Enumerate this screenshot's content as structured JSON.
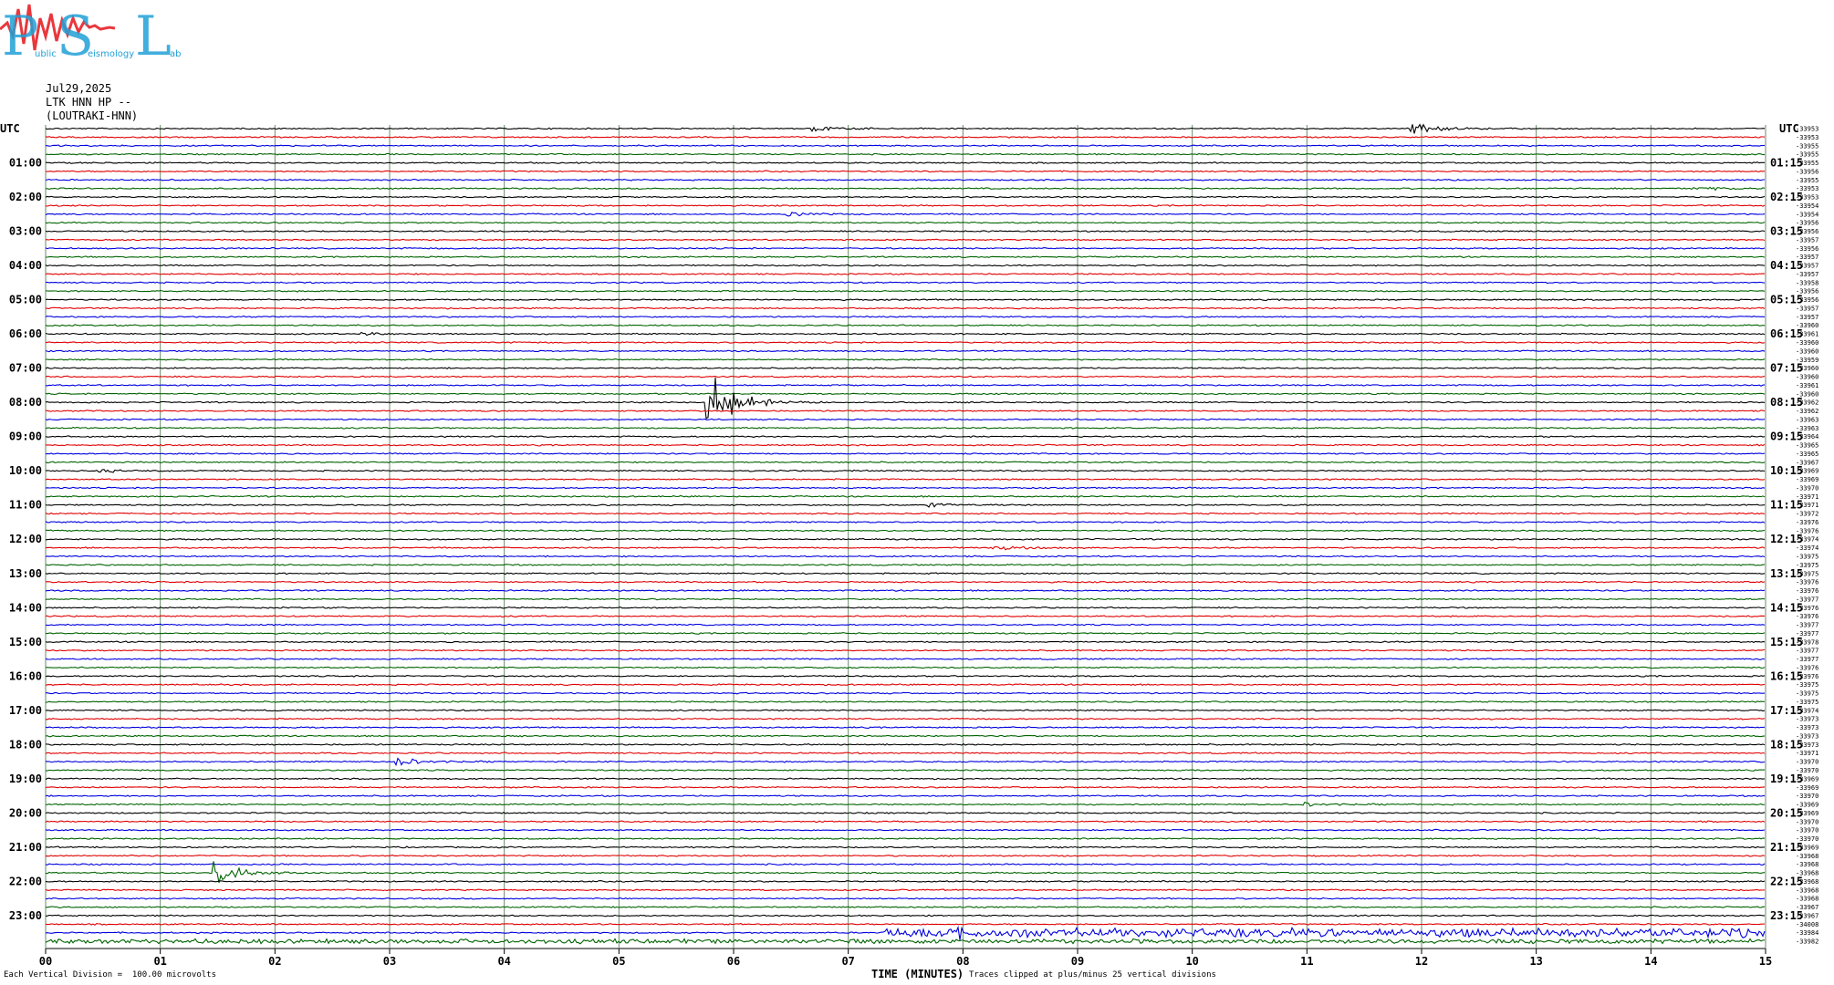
{
  "logo": {
    "letters": [
      "P",
      "S",
      "L"
    ],
    "words": [
      "ublic",
      "eismology",
      "ab"
    ],
    "colors": {
      "letters": "#22a0d6",
      "wave": "#e8383d"
    }
  },
  "header": {
    "date": "Jul29,2025",
    "station": "LTK HNN HP --",
    "location": "(LOUTRAKI-HNN)"
  },
  "chart_data": {
    "type": "line",
    "title": "",
    "xlabel": "TIME (MINUTES)",
    "xlim": [
      0,
      15
    ],
    "x_ticks": [
      "00",
      "01",
      "02",
      "03",
      "04",
      "05",
      "06",
      "07",
      "08",
      "09",
      "10",
      "11",
      "12",
      "13",
      "14",
      "15"
    ],
    "left_axis_label": "UTC",
    "right_axis_label": "UTC",
    "left_hour_labels": [
      "01:00",
      "02:00",
      "03:00",
      "04:00",
      "05:00",
      "06:00",
      "07:00",
      "08:00",
      "09:00",
      "10:00",
      "11:00",
      "12:00",
      "13:00",
      "14:00",
      "15:00",
      "16:00",
      "17:00",
      "18:00",
      "19:00",
      "20:00",
      "21:00",
      "22:00",
      "23:00"
    ],
    "right_hour_labels": [
      "01:15",
      "02:15",
      "03:15",
      "04:15",
      "05:15",
      "06:15",
      "07:15",
      "08:15",
      "09:15",
      "10:15",
      "11:15",
      "12:15",
      "13:15",
      "14:15",
      "15:15",
      "16:15",
      "17:15",
      "18:15",
      "19:15",
      "20:15",
      "21:15",
      "22:15",
      "23:15"
    ],
    "trace_count": 96,
    "trace_colors": [
      "#000000",
      "#e00000",
      "#0000e0",
      "#006400"
    ],
    "grid": true,
    "grid_color": "#6a8a6a",
    "right_values": [
      "-33953",
      "-33953",
      "-33955",
      "-33955",
      "-33955",
      "-33956",
      "-33955",
      "-33953",
      "-33953",
      "-33954",
      "-33954",
      "-33956",
      "-33956",
      "-33957",
      "-33956",
      "-33957",
      "-33957",
      "-33957",
      "-33958",
      "-33956",
      "-33956",
      "-33957",
      "-33957",
      "-33960",
      "-33961",
      "-33960",
      "-33960",
      "-33959",
      "-33960",
      "-33960",
      "-33961",
      "-33960",
      "-33962",
      "-33962",
      "-33963",
      "-33963",
      "-33964",
      "-33965",
      "-33965",
      "-33967",
      "-33969",
      "-33969",
      "-33970",
      "-33971",
      "-33971",
      "-33972",
      "-33976",
      "-33976",
      "-33974",
      "-33974",
      "-33975",
      "-33975",
      "-33975",
      "-33976",
      "-33976",
      "-33977",
      "-33976",
      "-33976",
      "-33977",
      "-33977",
      "-33978",
      "-33977",
      "-33977",
      "-33976",
      "-33976",
      "-33975",
      "-33975",
      "-33975",
      "-33974",
      "-33973",
      "-33973",
      "-33973",
      "-33973",
      "-33971",
      "-33970",
      "-33970",
      "-33969",
      "-33969",
      "-33970",
      "-33969",
      "-33969",
      "-33970",
      "-33970",
      "-33970",
      "-33969",
      "-33968",
      "-33968",
      "-33968",
      "-33968",
      "-33968",
      "-33968",
      "-33967",
      "-33967",
      "-34008",
      "-33984",
      "-33982"
    ],
    "events": [
      {
        "trace": 0,
        "minute": 6.72,
        "amp": 0.25
      },
      {
        "trace": 0,
        "minute": 11.95,
        "amp": 0.5
      },
      {
        "trace": 7,
        "minute": 14.4,
        "amp": 0.2
      },
      {
        "trace": 10,
        "minute": 6.5,
        "amp": 0.2
      },
      {
        "trace": 24,
        "minute": 2.8,
        "amp": 0.2
      },
      {
        "trace": 32,
        "minute": 5.8,
        "amp": 3.2
      },
      {
        "trace": 40,
        "minute": 0.5,
        "amp": 0.15
      },
      {
        "trace": 44,
        "minute": 7.7,
        "amp": 0.2
      },
      {
        "trace": 49,
        "minute": 8.3,
        "amp": 0.3
      },
      {
        "trace": 74,
        "minute": 3.1,
        "amp": 0.4
      },
      {
        "trace": 79,
        "minute": 11.0,
        "amp": 0.2
      },
      {
        "trace": 87,
        "minute": 1.5,
        "amp": 1.4
      },
      {
        "trace": 94,
        "minute": 8.0,
        "amp": 0.4
      }
    ],
    "noisy_segments": [
      {
        "trace": 94,
        "from": 7.3,
        "to": 15,
        "amp": 0.35
      },
      {
        "trace": 95,
        "from": 0,
        "to": 15,
        "amp": 0.15
      }
    ]
  },
  "footer": {
    "division_note": "Each Vertical Division =  100.00 microvolts",
    "clip_note": "Traces clipped at plus/minus 25 vertical divisions"
  }
}
